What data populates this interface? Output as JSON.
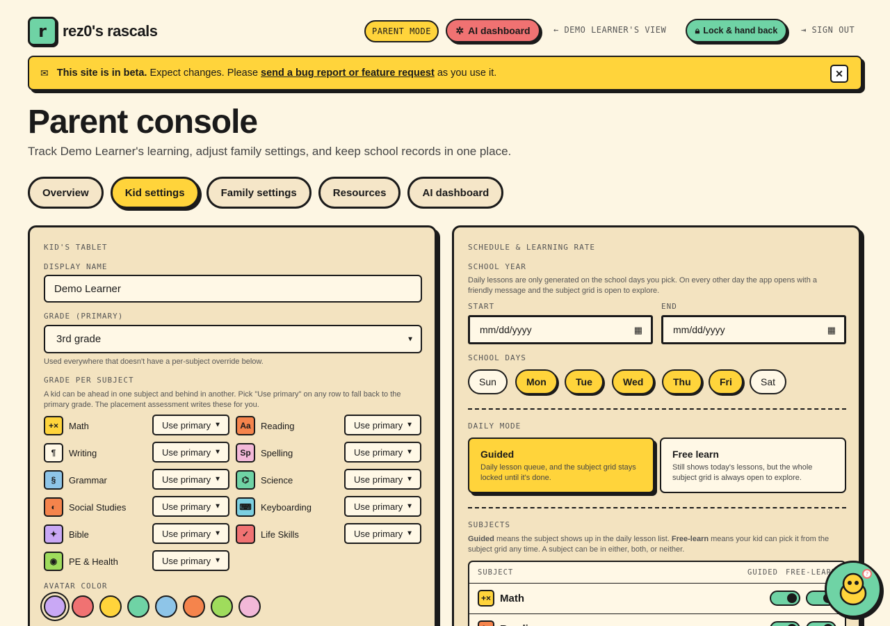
{
  "header": {
    "logo_letter": "r",
    "brand": "rez0's rascals",
    "parent_mode": "PARENT MODE",
    "ai_dashboard": "AI dashboard",
    "learner_view": "← DEMO LEARNER'S VIEW",
    "lock_hand_back": "Lock & hand back",
    "sign_out": "SIGN OUT"
  },
  "beta": {
    "bold": "This site is in beta.",
    "text": "Expect changes. Please",
    "link": "send a bug report or feature request",
    "suffix": "as you use it."
  },
  "page": {
    "title": "Parent console",
    "subtitle": "Track Demo Learner's learning, adjust family settings, and keep school records in one place."
  },
  "tabs": [
    "Overview",
    "Kid settings",
    "Family settings",
    "Resources",
    "AI dashboard"
  ],
  "active_tab": "Kid settings",
  "kid_tablet": {
    "section": "KID'S TABLET",
    "display_name_label": "DISPLAY NAME",
    "display_name": "Demo Learner",
    "grade_label": "GRADE (PRIMARY)",
    "grade": "3rd grade",
    "grade_help": "Used everywhere that doesn't have a per-subject override below.",
    "per_subject_label": "GRADE PER SUBJECT",
    "per_subject_help": "A kid can be ahead in one subject and behind in another. Pick \"Use primary\" on any row to fall back to the primary grade. The placement assessment writes these for you.",
    "subjects": [
      {
        "name": "Math",
        "icon": "+×",
        "color": "#ffd43b",
        "value": "Use primary"
      },
      {
        "name": "Reading",
        "icon": "Aa",
        "color": "#f5844c",
        "value": "Use primary"
      },
      {
        "name": "Writing",
        "icon": "¶",
        "color": "#fff8e6",
        "value": "Use primary"
      },
      {
        "name": "Spelling",
        "icon": "Sp",
        "color": "#f2b8d8",
        "value": "Use primary"
      },
      {
        "name": "Grammar",
        "icon": "§",
        "color": "#8ec5e8",
        "value": "Use primary"
      },
      {
        "name": "Science",
        "icon": "⌬",
        "color": "#6fd3a5",
        "value": "Use primary"
      },
      {
        "name": "Social Studies",
        "icon": "◐",
        "color": "#f5844c",
        "value": "Use primary"
      },
      {
        "name": "Keyboarding",
        "icon": "⌨",
        "color": "#7ccfe0",
        "value": "Use primary"
      },
      {
        "name": "Bible",
        "icon": "✦",
        "color": "#c9a8f5",
        "value": "Use primary"
      },
      {
        "name": "Life Skills",
        "icon": "✓",
        "color": "#f07272",
        "value": "Use primary"
      },
      {
        "name": "PE & Health",
        "icon": "◉",
        "color": "#9fdc5c",
        "value": "Use primary"
      }
    ],
    "avatar_label": "AVATAR COLOR",
    "avatar_colors": [
      "#c9a8f5",
      "#f07272",
      "#ffd43b",
      "#6fd3a5",
      "#8ec5e8",
      "#f5844c",
      "#9fdc5c",
      "#f2b8d8"
    ],
    "avatar_selected": 0
  },
  "schedule": {
    "section": "SCHEDULE & LEARNING RATE",
    "school_year_label": "SCHOOL YEAR",
    "school_year_help": "Daily lessons are only generated on the school days you pick. On every other day the app opens with a friendly message and the subject grid is open to explore.",
    "start_label": "START",
    "end_label": "END",
    "start_placeholder": "mm/dd/yyyy",
    "end_placeholder": "mm/dd/yyyy",
    "school_days_label": "SCHOOL DAYS",
    "days": [
      {
        "name": "Sun",
        "on": false
      },
      {
        "name": "Mon",
        "on": true
      },
      {
        "name": "Tue",
        "on": true
      },
      {
        "name": "Wed",
        "on": true
      },
      {
        "name": "Thu",
        "on": true
      },
      {
        "name": "Fri",
        "on": true
      },
      {
        "name": "Sat",
        "on": false
      }
    ],
    "daily_mode_label": "DAILY MODE",
    "modes": [
      {
        "title": "Guided",
        "desc": "Daily lesson queue, and the subject grid stays locked until it's done.",
        "on": true
      },
      {
        "title": "Free learn",
        "desc": "Still shows today's lessons, but the whole subject grid is always open to explore.",
        "on": false
      }
    ],
    "subjects_label": "SUBJECTS",
    "subjects_help_guided": "Guided",
    "subjects_help_1": "means the subject shows up in the daily lesson list.",
    "subjects_help_free": "Free-learn",
    "subjects_help_2": "means your kid can pick it from the subject grid any time. A subject can be in either, both, or neither.",
    "table_headers": {
      "subject": "SUBJECT",
      "guided": "GUIDED",
      "free": "FREE-LEARN"
    },
    "rows": [
      {
        "name": "Math",
        "icon": "+×",
        "color": "#ffd43b",
        "guided": true,
        "free": true
      },
      {
        "name": "Reading",
        "icon": "Aa",
        "color": "#f5844c",
        "guided": true,
        "free": true
      }
    ]
  }
}
